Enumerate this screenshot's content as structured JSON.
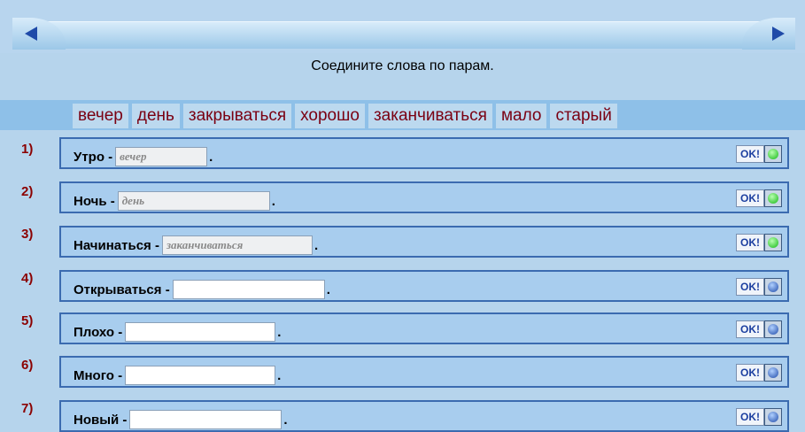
{
  "instruction": "Соедините слова по парам.",
  "word_bank": [
    "вечер",
    "день",
    "закрываться",
    "хорошо",
    "заканчиваться",
    "мало",
    "старый"
  ],
  "ok_label": "OK!",
  "rows": [
    {
      "num": "1)",
      "prompt": "Утро -",
      "answer": "вечер",
      "placeholder": "",
      "status": "green"
    },
    {
      "num": "2)",
      "prompt": "Ночь -",
      "answer": "день",
      "placeholder": "",
      "status": "green"
    },
    {
      "num": "3)",
      "prompt": "Начинаться -",
      "answer": "заканчиваться",
      "placeholder": "",
      "status": "green"
    },
    {
      "num": "4)",
      "prompt": "Открываться -",
      "answer": "",
      "placeholder": "",
      "status": "blue"
    },
    {
      "num": "5)",
      "prompt": "Плохо -",
      "answer": "",
      "placeholder": "",
      "status": "blue"
    },
    {
      "num": "6)",
      "prompt": "Много -",
      "answer": "",
      "placeholder": "",
      "status": "blue"
    },
    {
      "num": "7)",
      "prompt": "Новый -",
      "answer": "",
      "placeholder": "",
      "status": "blue"
    }
  ],
  "end_punct": ".",
  "colors": {
    "status_green": "#14b814",
    "status_blue": "#1f4aa8",
    "word_text": "#7a0012"
  }
}
